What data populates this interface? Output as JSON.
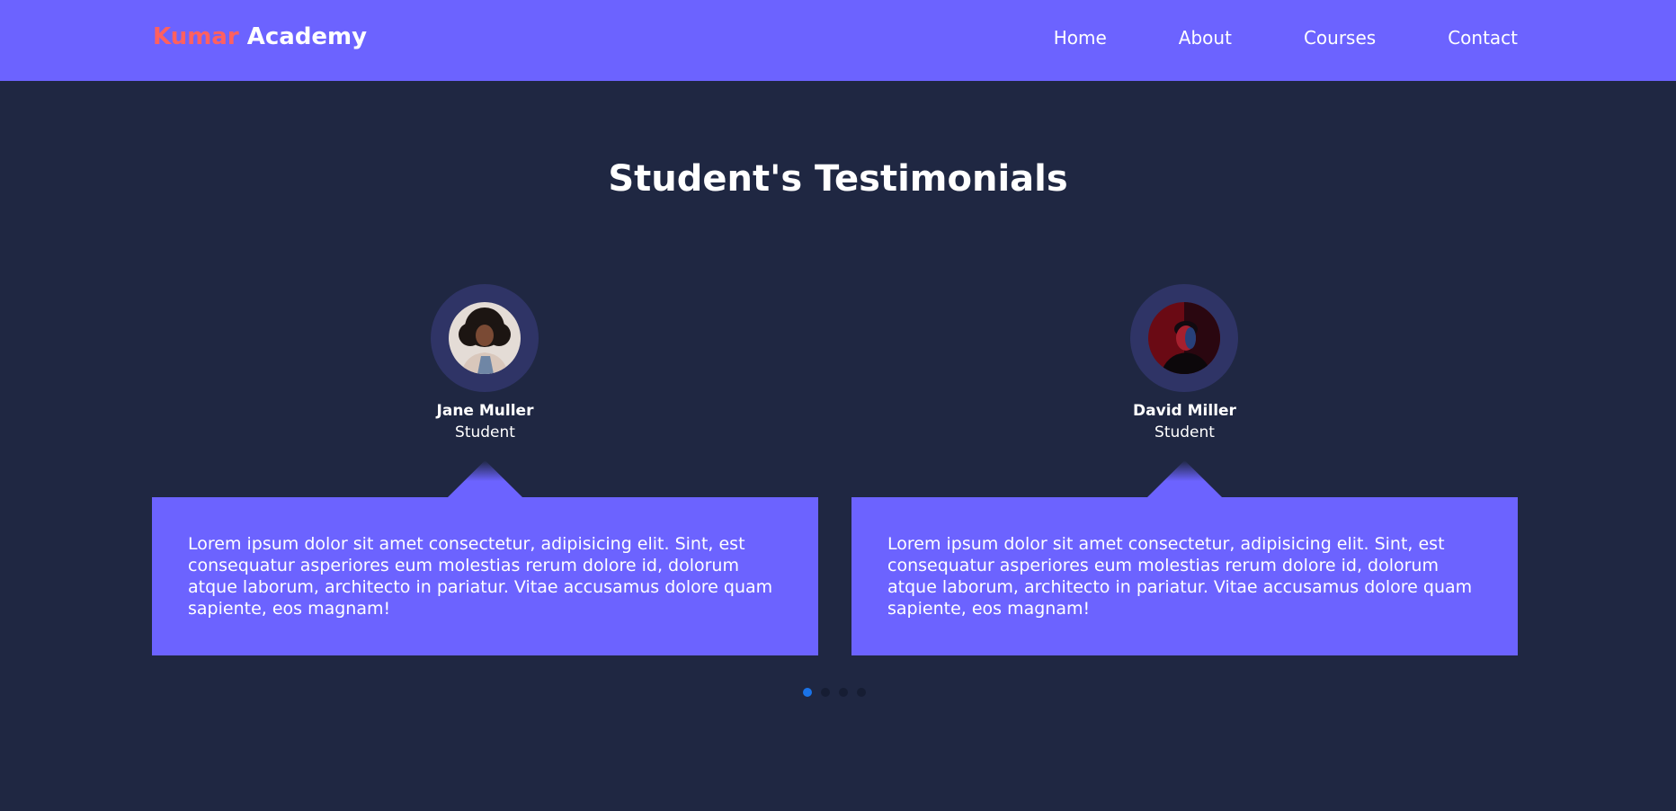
{
  "brand": {
    "accent": "Kumar",
    "main": "Academy"
  },
  "nav": {
    "links": [
      "Home",
      "About",
      "Courses",
      "Contact"
    ]
  },
  "section": {
    "title": "Student's Testimonials"
  },
  "testimonials": [
    {
      "name": "Jane Muller",
      "role": "Student",
      "text": "Lorem ipsum dolor sit amet consectetur, adipisicing elit. Sint, est consequatur asperiores eum molestias rerum dolore id, dolorum atque laborum, architecto in pariatur. Vitae accusamus dolore quam sapiente, eos magnam!"
    },
    {
      "name": "David Miller",
      "role": "Student",
      "text": "Lorem ipsum dolor sit amet consectetur, adipisicing elit. Sint, est consequatur asperiores eum molestias rerum dolore id, dolorum atque laborum, architecto in pariatur. Vitae accusamus dolore quam sapiente, eos magnam!"
    }
  ],
  "carousel": {
    "total_slides": 4,
    "active_slide": 1
  },
  "colors": {
    "page_background": "#1f2742",
    "primary": "#6c63ff",
    "brand_accent": "#ff6060",
    "avatar_ring": "#2f3466",
    "dot_active": "#1a73e8",
    "dot_inactive": "#161d33"
  }
}
